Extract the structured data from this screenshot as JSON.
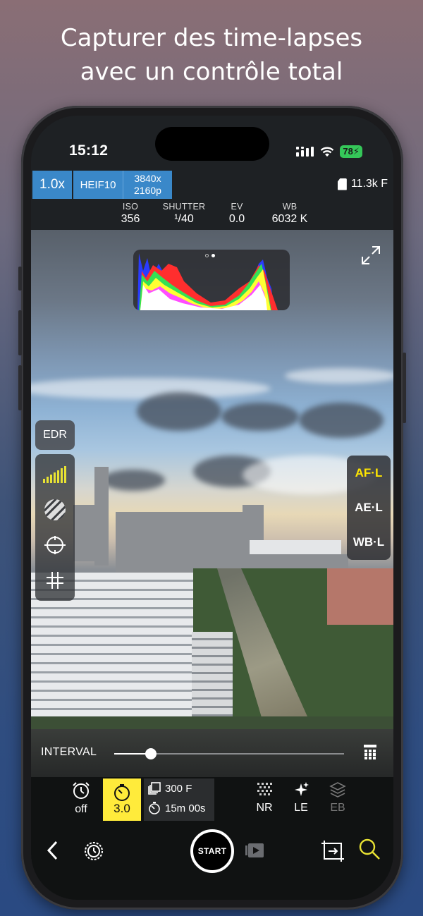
{
  "headline": {
    "line1": "Capturer des time-lapses",
    "line2": "avec un contrôle total"
  },
  "status_bar": {
    "time": "15:12",
    "battery": "78"
  },
  "top_bar": {
    "zoom": "1.0x",
    "format": "HEIF10",
    "resolution_w": "3840x",
    "resolution_h": "2160p",
    "frames_remaining": "11.3k F"
  },
  "exif": {
    "iso_label": "ISO",
    "iso_value": "356",
    "shutter_label": "SHUTTER",
    "shutter_value": "¹/40",
    "ev_label": "EV",
    "ev_value": "0.0",
    "wb_label": "WB",
    "wb_value": "6032 K"
  },
  "viewfinder": {
    "edr_label": "EDR",
    "histogram_page": 2,
    "histogram_pages": 2
  },
  "locks": {
    "af": "AF·L",
    "ae": "AE·L",
    "wb": "WB·L",
    "active": "af",
    "active_color": "#ffe600"
  },
  "interval": {
    "label": "INTERVAL",
    "slider_value": 0.16
  },
  "controls": {
    "delay_value": "off",
    "timer_value": "3.0",
    "frames": "300 F",
    "duration": "15m 00s",
    "nr_label": "NR",
    "le_label": "LE",
    "eb_label": "EB",
    "start_label": "START"
  },
  "colors": {
    "accent_blue": "#3a88c9",
    "highlight_yellow": "#ffeb3b"
  }
}
